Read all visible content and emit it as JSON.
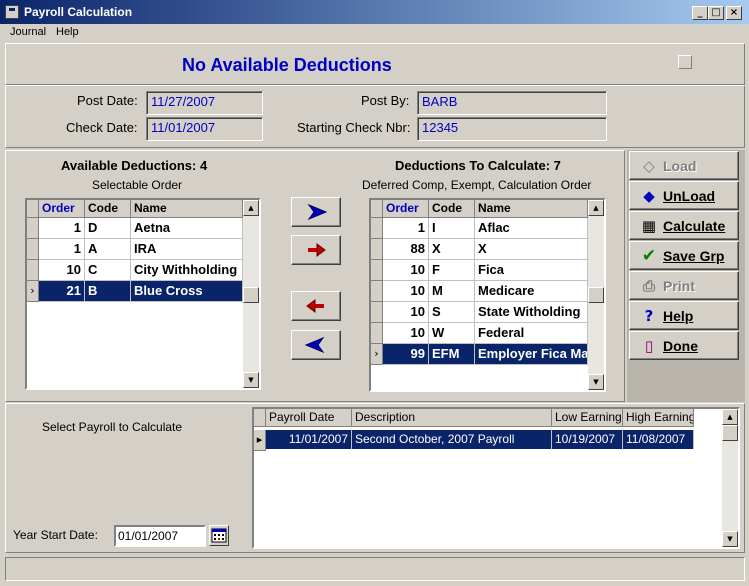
{
  "window": {
    "title": "Payroll Calculation"
  },
  "menu": {
    "items": [
      "Journal",
      "Help"
    ]
  },
  "header": {
    "title": "No Available Deductions"
  },
  "fields": {
    "post_date_label": "Post Date:",
    "post_date": "11/27/2007",
    "check_date_label": "Check Date:",
    "check_date": "11/01/2007",
    "post_by_label": "Post By:",
    "post_by": "BARB",
    "starting_check_label": "Starting Check Nbr:",
    "starting_check": "12345"
  },
  "available": {
    "title": "Available Deductions: 4",
    "subtitle": "Selectable Order",
    "columns": [
      "Order",
      "Code",
      "Name"
    ],
    "rows": [
      {
        "order": "1",
        "code": "D",
        "name": "Aetna"
      },
      {
        "order": "1",
        "code": "A",
        "name": "IRA"
      },
      {
        "order": "10",
        "code": "C",
        "name": "City Withholding"
      },
      {
        "order": "21",
        "code": "B",
        "name": "Blue Cross"
      }
    ]
  },
  "to_calculate": {
    "title": "Deductions To Calculate: 7",
    "subtitle": "Deferred Comp, Exempt, Calculation Order",
    "columns": [
      "Order",
      "Code",
      "Name"
    ],
    "rows": [
      {
        "order": "1",
        "code": "I",
        "name": "Aflac"
      },
      {
        "order": "88",
        "code": "X",
        "name": "X"
      },
      {
        "order": "10",
        "code": "F",
        "name": "Fica"
      },
      {
        "order": "10",
        "code": "M",
        "name": "Medicare"
      },
      {
        "order": "10",
        "code": "S",
        "name": "State Witholding"
      },
      {
        "order": "10",
        "code": "W",
        "name": "Federal"
      },
      {
        "order": "99",
        "code": "EFM",
        "name": "Employer Fica Match"
      }
    ]
  },
  "buttons": {
    "load": "Load",
    "unload": "UnLoad",
    "calculate": "Calculate",
    "save_grp": "Save Grp",
    "print": "Print",
    "help": "Help",
    "done": "Done"
  },
  "payroll": {
    "select_label": "Select Payroll to Calculate",
    "year_start_label": "Year Start Date:",
    "year_start": "01/01/2007",
    "columns": [
      "Payroll Date",
      "Description",
      "Low Earnings",
      "High Earnings"
    ],
    "rows": [
      {
        "date": "11/01/2007",
        "description": "Second October, 2007 Payroll",
        "low": "10/19/2007",
        "high": "11/08/2007"
      }
    ]
  },
  "colors": {
    "accent_blue": "#0000c0",
    "selection": "#0a246a",
    "titlebar": "#0a246a"
  },
  "icons": {
    "move_right": "arrow-right-blue-icon",
    "move_right_all": "arrow-right-red-icon",
    "move_left": "arrow-left-red-icon",
    "move_left_all": "arrow-left-blue-icon",
    "calendar": "calendar-icon"
  }
}
